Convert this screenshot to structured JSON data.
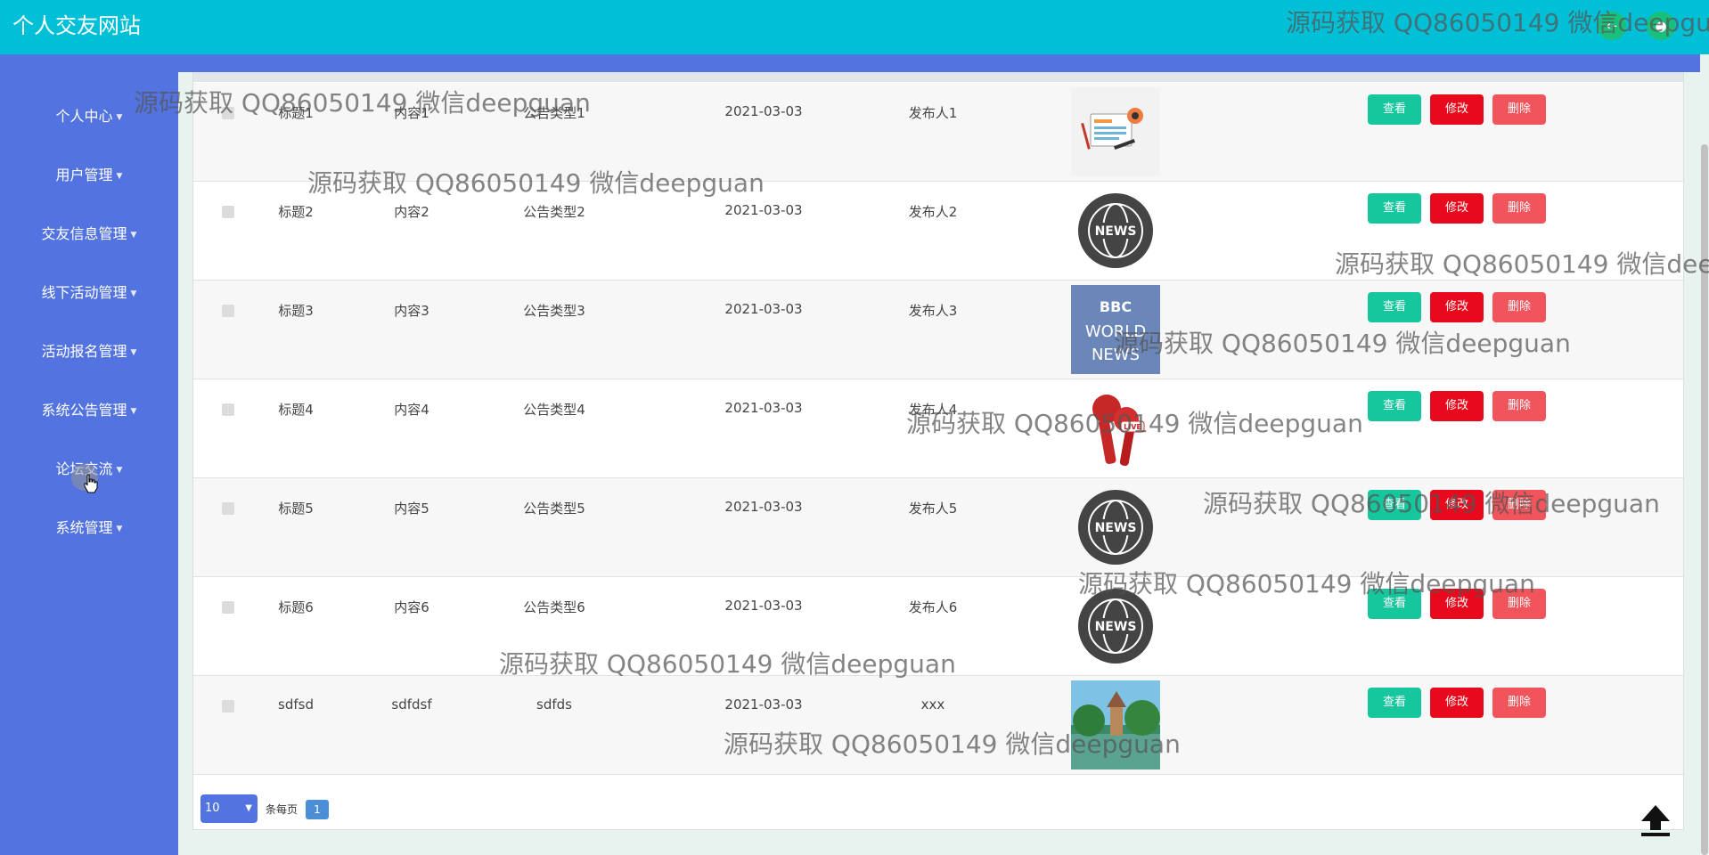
{
  "app": {
    "title": "个人交友网站"
  },
  "header": {
    "icons": [
      "back-icon",
      "user-icon"
    ]
  },
  "sidebar": {
    "items": [
      {
        "label": "个人中心"
      },
      {
        "label": "用户管理"
      },
      {
        "label": "交友信息管理"
      },
      {
        "label": "线下活动管理"
      },
      {
        "label": "活动报名管理"
      },
      {
        "label": "系统公告管理"
      },
      {
        "label": "论坛交流"
      },
      {
        "label": "系统管理"
      }
    ]
  },
  "table": {
    "buttons": {
      "view": "查看",
      "edit": "修改",
      "delete": "删除"
    },
    "rows": [
      {
        "title": "标题1",
        "content": "内容1",
        "type": "公告类型1",
        "date": "2021-03-03",
        "publisher": "发布人1",
        "image": "news-illustration"
      },
      {
        "title": "标题2",
        "content": "内容2",
        "type": "公告类型2",
        "date": "2021-03-03",
        "publisher": "发布人2",
        "image": "news-globe"
      },
      {
        "title": "标题3",
        "content": "内容3",
        "type": "公告类型3",
        "date": "2021-03-03",
        "publisher": "发布人3",
        "image": "bbc-world-news"
      },
      {
        "title": "标题4",
        "content": "内容4",
        "type": "公告类型4",
        "date": "2021-03-03",
        "publisher": "发布人4",
        "image": "live-microphone"
      },
      {
        "title": "标题5",
        "content": "内容5",
        "type": "公告类型5",
        "date": "2021-03-03",
        "publisher": "发布人5",
        "image": "news-globe"
      },
      {
        "title": "标题6",
        "content": "内容6",
        "type": "公告类型6",
        "date": "2021-03-03",
        "publisher": "发布人6",
        "image": "news-globe"
      },
      {
        "title": "sdfsd",
        "content": "sdfdsf",
        "type": "sdfds",
        "date": "2021-03-03",
        "publisher": "xxx",
        "image": "landscape-photo"
      }
    ]
  },
  "thumb_text": {
    "news": "NEWS",
    "bbc": "BBC",
    "world": "WORLD",
    "news2": "NEWS",
    "live": "LIVE"
  },
  "pagination": {
    "page_size": "10",
    "per_page_label": "条每页",
    "current_page": "1"
  },
  "watermark": {
    "text": "源码获取 QQ86050149 微信deepguan"
  },
  "colors": {
    "header": "#00c0d8",
    "sidebar": "#5374e0",
    "view_button": "#16c79e",
    "edit_button": "#e8091c",
    "delete_button": "#f2545b"
  }
}
